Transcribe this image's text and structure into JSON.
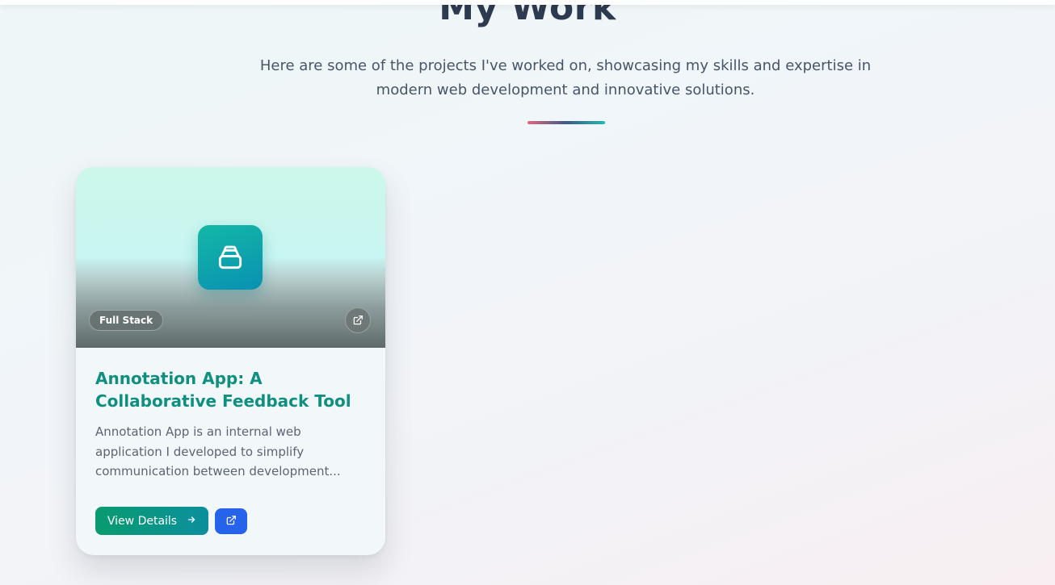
{
  "header": {
    "title": "My Work",
    "subtitle": "Here are some of the projects I've worked on, showcasing my skills and expertise in modern web development and innovative solutions."
  },
  "colors": {
    "accent_gradient": [
      "#e2677f",
      "#3d5b86",
      "#22b8b0"
    ],
    "title": "#2d3a4f",
    "card_title": "#0f8f7f",
    "primary_button": "#0a9b6e",
    "secondary_button": "#2563eb"
  },
  "projects": [
    {
      "icon": "inbox-stack-icon",
      "category": "Full Stack",
      "title": "Annotation App: A Collaborative Feedback Tool",
      "description": "Annotation App is an internal web application I developed to simplify communication between development...",
      "view_details_label": "View Details",
      "view_details_icon": "arrow-right-icon",
      "external_icon": "external-link-icon"
    }
  ]
}
